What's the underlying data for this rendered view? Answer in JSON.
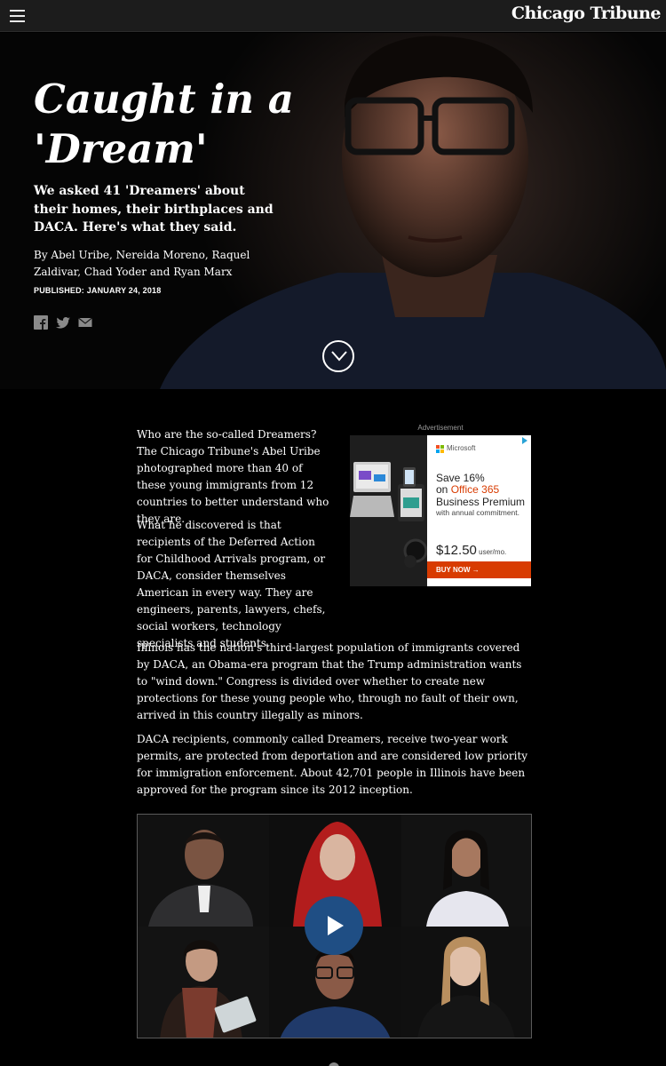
{
  "header": {
    "menu_icon": "hamburger-menu-icon",
    "logo_text": "Chicago Tribune"
  },
  "hero": {
    "headline": "Caught in a 'Dream'",
    "dek": "We asked 41 'Dreamers' about their homes, their birthplaces and DACA. Here's what they said.",
    "byline": "By Abel Uribe, Nereida Moreno, Raquel Zaldivar, Chad Yoder and Ryan Marx",
    "published": "PUBLISHED: JANUARY 24, 2018",
    "share_icons": [
      "facebook-icon",
      "twitter-icon",
      "email-icon"
    ],
    "scroll_icon": "chevron-down-icon"
  },
  "article": {
    "paragraphs": [
      "Who are the so-called Dreamers? The Chicago Tribune's Abel Uribe photographed more than 40 of these young immigrants from 12 countries to better understand who they are.",
      "What he discovered is that recipients of the Deferred Action for Childhood Arrivals program, or DACA, consider themselves American in every way. They are engineers, parents, lawyers, chefs, social workers, technology specialists and students.",
      "Illinois has the nation's third-largest population of immigrants covered by DACA, an Obama-era program that the Trump administration wants to \"wind down.\" Congress is divided over whether to create new protections for these young people who, through no fault of their own, arrived in this country illegally as minors.",
      "DACA recipients, commonly called Dreamers, receive two-year work permits, are protected from deportation and are considered low priority for immigration enforcement. About 42,701 people in Illinois have been approved for the program since its 2012 inception."
    ]
  },
  "ad": {
    "label": "Advertisement",
    "brand": "Microsoft",
    "line1": "Save 16%",
    "line2_prefix": "on ",
    "line2_brand": "Office 365",
    "line3": "Business Premium",
    "line4": "with annual commitment.",
    "price": "$12.50",
    "price_unit": " user/mo.",
    "cta": "BUY NOW  →",
    "colors": {
      "accent": "#d83b01"
    }
  },
  "video": {
    "play_icon": "play-icon"
  },
  "colors": {
    "background": "#000000",
    "topbar": "#1c1c1c",
    "play_button": "#1f4e84"
  }
}
